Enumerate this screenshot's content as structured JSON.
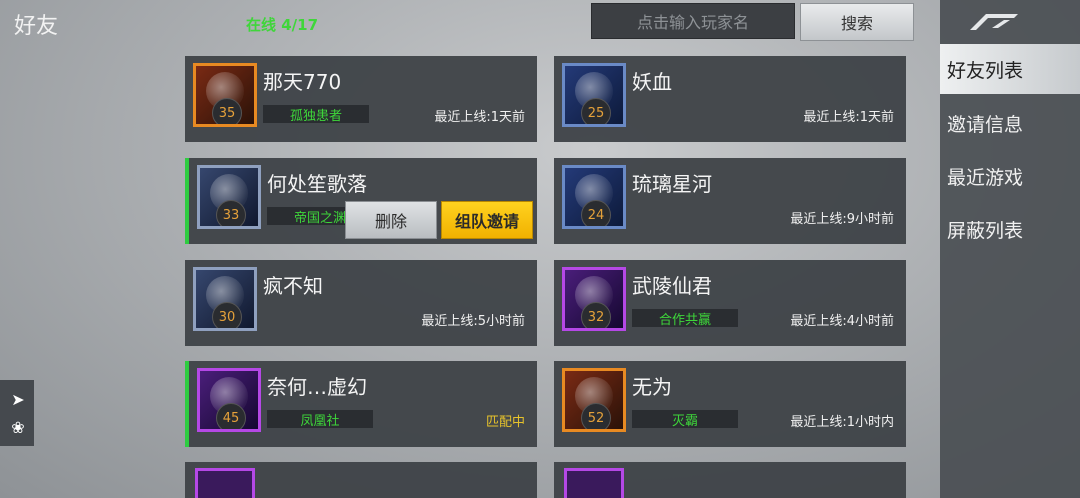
{
  "header": {
    "title": "好友",
    "online_status": "在线 4/17",
    "search_placeholder": "点击输入玩家名",
    "search_button": "搜索"
  },
  "sidebar": {
    "logo_icon": "game-logo-icon",
    "items": [
      {
        "label": "好友列表",
        "active": true
      },
      {
        "label": "邀请信息",
        "active": false
      },
      {
        "label": "最近游戏",
        "active": false
      },
      {
        "label": "屏蔽列表",
        "active": false
      }
    ]
  },
  "friends": [
    {
      "name": "那天770",
      "level": "35",
      "guild": "孤独患者",
      "status": "最近上线:1天前"
    },
    {
      "name": "妖血",
      "level": "25",
      "guild": "",
      "status": "最近上线:1天前"
    },
    {
      "name": "何处笙歌落",
      "level": "33",
      "guild": "帝国之渊",
      "status": ""
    },
    {
      "name": "琉璃星河",
      "level": "24",
      "guild": "",
      "status": "最近上线:9小时前"
    },
    {
      "name": "疯不知",
      "level": "30",
      "guild": "",
      "status": "最近上线:5小时前"
    },
    {
      "name": "武陵仙君",
      "level": "32",
      "guild": "合作共赢",
      "status": "最近上线:4小时前"
    },
    {
      "name": "奈何…虚幻",
      "level": "45",
      "guild": "凤凰社",
      "status": "匹配中"
    },
    {
      "name": "无为",
      "level": "52",
      "guild": "灭霸",
      "status": "最近上线:1小时内"
    }
  ],
  "actions": {
    "delete": "删除",
    "team_invite": "组队邀请"
  },
  "colors": {
    "online_green": "#3fd63a",
    "invite_yellow": "#f5c400",
    "matching_yellow": "#e6c22b"
  }
}
